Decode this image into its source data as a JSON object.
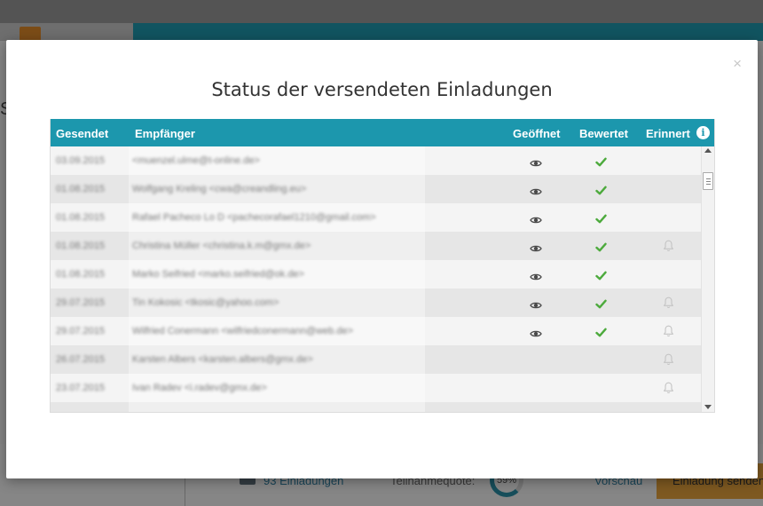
{
  "background": {
    "invitations_link": "93 Einladungen",
    "quota_label": "Teilnahmequote:",
    "quota_value": "59%",
    "preview_link": "Vorschau",
    "send_button": "Einladung senden"
  },
  "modal": {
    "title": "Status der versendeten Einladungen",
    "close_symbol": "×",
    "columns": {
      "sent": "Gesendet",
      "recipient": "Empfänger",
      "opened": "Geöffnet",
      "rated": "Bewertet",
      "reminded": "Erinnert"
    },
    "info_symbol": "i",
    "rows": [
      {
        "date": "03.09.2015",
        "recipient": "<muenzel.ulme@t-online.de>",
        "opened": true,
        "rated": true,
        "bell": false,
        "shade": "odd"
      },
      {
        "date": "01.08.2015",
        "recipient": "Wolfgang Kreling <cwa@creandling.eu>",
        "opened": true,
        "rated": true,
        "bell": false,
        "shade": "even"
      },
      {
        "date": "01.08.2015",
        "recipient": "Rafael Pacheco Lo D <pachecorafael1210@gmail.com>",
        "opened": true,
        "rated": true,
        "bell": false,
        "shade": "odd"
      },
      {
        "date": "01.08.2015",
        "recipient": "Christina Müller <christina.k.m@gmx.de>",
        "opened": true,
        "rated": true,
        "bell": true,
        "shade": "even"
      },
      {
        "date": "01.08.2015",
        "recipient": "Marko Seifried <marko.seifried@ok.de>",
        "opened": true,
        "rated": true,
        "bell": false,
        "shade": "odd"
      },
      {
        "date": "29.07.2015",
        "recipient": "Tin Kokosic <tkosic@yahoo.com>",
        "opened": true,
        "rated": true,
        "bell": true,
        "shade": "even"
      },
      {
        "date": "29.07.2015",
        "recipient": "Wilfried Conermann <wilfriedconermann@web.de>",
        "opened": true,
        "rated": true,
        "bell": true,
        "shade": "odd"
      },
      {
        "date": "26.07.2015",
        "recipient": "Karsten Albers <karsten.albers@gmx.de>",
        "opened": false,
        "rated": false,
        "bell": true,
        "shade": "even"
      },
      {
        "date": "23.07.2015",
        "recipient": "Ivan Radev <i.radev@gmx.de>",
        "opened": false,
        "rated": false,
        "bell": true,
        "shade": "odd"
      },
      {
        "date": "",
        "recipient": "",
        "opened": false,
        "rated": false,
        "bell": false,
        "shade": "even"
      }
    ],
    "colors": {
      "header": "#1c97ad",
      "check": "#4caa3c",
      "eye": "#4a4a4a",
      "bell": "#c4c4c4"
    }
  }
}
